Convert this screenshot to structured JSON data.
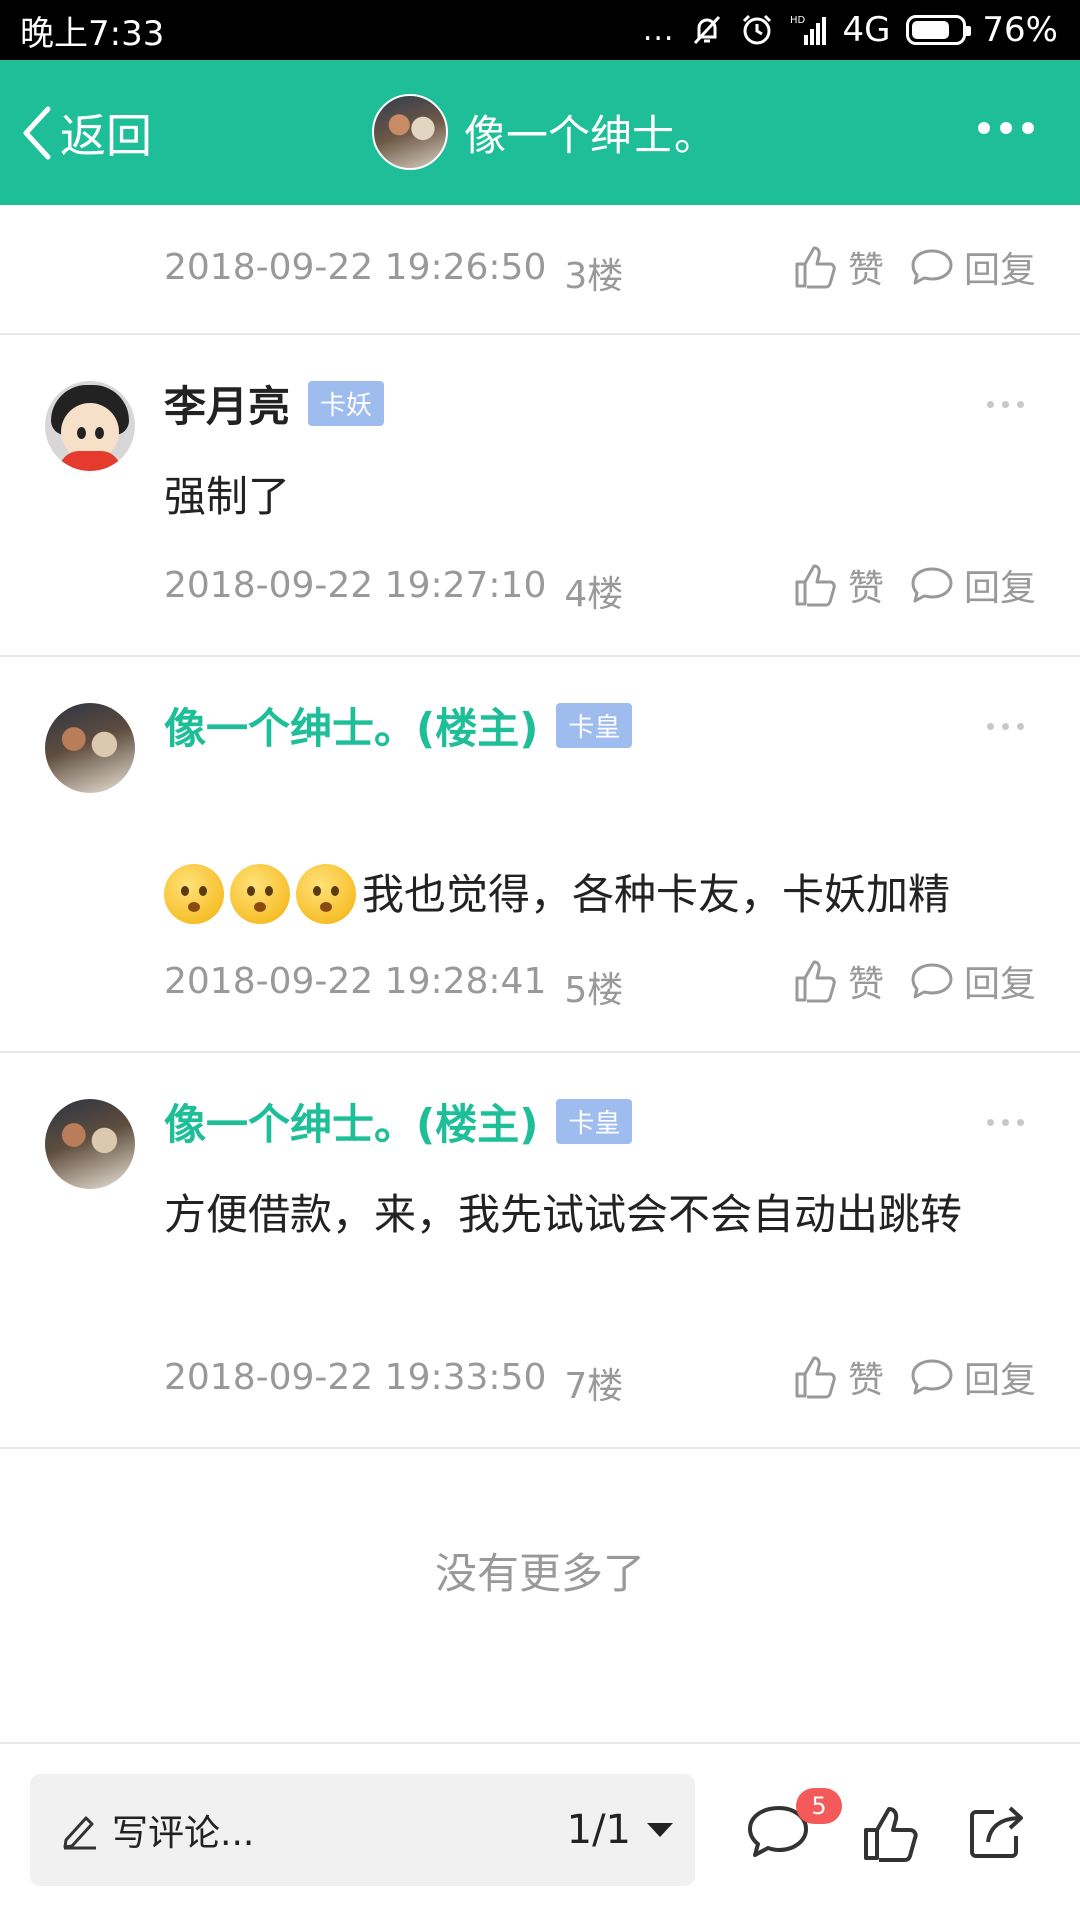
{
  "status_bar": {
    "time": "晚上7:33",
    "signal_dots": "...",
    "hd": "HD",
    "network": "4G",
    "battery": "76%",
    "battery_level": 0.76
  },
  "nav": {
    "back_label": "返回",
    "title": "像一个绅士。"
  },
  "posts": [
    {
      "timestamp": "2018-09-22 19:26:50",
      "floor": "3楼",
      "like_label": "赞",
      "reply_label": "回复"
    },
    {
      "author": "李月亮",
      "rank": "卡妖",
      "content": "强制了",
      "timestamp": "2018-09-22 19:27:10",
      "floor": "4楼",
      "like_label": "赞",
      "reply_label": "回复"
    },
    {
      "author": "像一个绅士。(楼主)",
      "rank": "卡皇",
      "content": "我也觉得，各种卡友，卡妖加精",
      "emoji_count": 3,
      "timestamp": "2018-09-22 19:28:41",
      "floor": "5楼",
      "like_label": "赞",
      "reply_label": "回复"
    },
    {
      "author": "像一个绅士。(楼主)",
      "rank": "卡皇",
      "content": "方便借款，来，我先试试会不会自动出跳转",
      "timestamp": "2018-09-22 19:33:50",
      "floor": "7楼",
      "like_label": "赞",
      "reply_label": "回复"
    }
  ],
  "footer": {
    "no_more": "没有更多了"
  },
  "bottom_bar": {
    "comment_placeholder": "写评论...",
    "page_indicator": "1/1",
    "comment_badge": "5"
  },
  "colors": {
    "brand_green": "#1dbe98",
    "rank_badge_blue": "#9fbcef",
    "notification_red": "#f45a5a",
    "meta_gray": "#999999"
  }
}
